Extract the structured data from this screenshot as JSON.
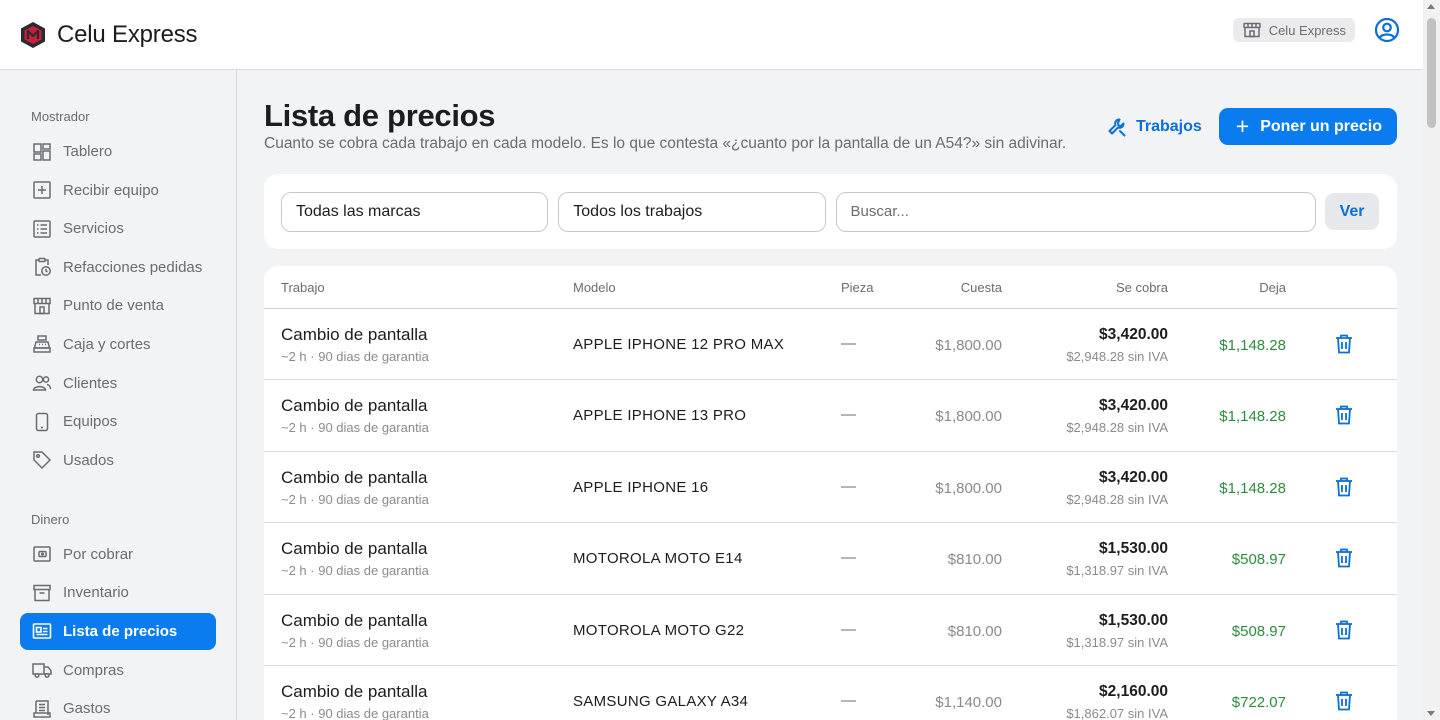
{
  "header": {
    "brand_name": "Celu Express",
    "store_chip": "Celu Express"
  },
  "colors": {
    "accent": "#0a7cf0",
    "profit_green": "#2e8b3e"
  },
  "sidebar": {
    "section_1": "Mostrador",
    "section_2": "Dinero",
    "items": [
      {
        "label": "Tablero",
        "icon": "dashboard-icon"
      },
      {
        "label": "Recibir equipo",
        "icon": "plus-square-icon"
      },
      {
        "label": "Servicios",
        "icon": "list-icon"
      },
      {
        "label": "Refacciones pedidas",
        "icon": "clipboard-clock-icon"
      },
      {
        "label": "Punto de venta",
        "icon": "store-icon"
      },
      {
        "label": "Caja y cortes",
        "icon": "cash-register-icon"
      },
      {
        "label": "Clientes",
        "icon": "users-icon"
      },
      {
        "label": "Equipos",
        "icon": "phone-icon"
      },
      {
        "label": "Usados",
        "icon": "tag-icon"
      },
      {
        "label": "Por cobrar",
        "icon": "wallet-icon"
      },
      {
        "label": "Inventario",
        "icon": "archive-icon"
      },
      {
        "label": "Lista de precios",
        "icon": "price-list-icon",
        "active": true
      },
      {
        "label": "Compras",
        "icon": "truck-icon"
      },
      {
        "label": "Gastos",
        "icon": "receipt-icon"
      }
    ]
  },
  "page": {
    "title": "Lista de precios",
    "subtitle": "Cuanto se cobra cada trabajo en cada modelo. Es lo que contesta «¿cuanto por la pantalla de un A54?» sin adivinar.",
    "trabajos_label": "Trabajos",
    "add_price_label": "Poner un precio"
  },
  "filters": {
    "brand": "Todas las marcas",
    "job": "Todos los trabajos",
    "search_placeholder": "Buscar...",
    "search_value": "",
    "ver_label": "Ver"
  },
  "table": {
    "headers": {
      "job": "Trabajo",
      "model": "Modelo",
      "part": "Pieza",
      "cost": "Cuesta",
      "price": "Se cobra",
      "profit": "Deja"
    },
    "rows": [
      {
        "job": "Cambio de pantalla",
        "meta": "~2 h · 90 dias de garantia",
        "model": "APPLE IPHONE 12 PRO MAX",
        "part": "—",
        "cost": "$1,800.00",
        "price": "$3,420.00",
        "price_net": "$2,948.28 sin IVA",
        "profit": "$1,148.28"
      },
      {
        "job": "Cambio de pantalla",
        "meta": "~2 h · 90 dias de garantia",
        "model": "APPLE IPHONE 13 PRO",
        "part": "—",
        "cost": "$1,800.00",
        "price": "$3,420.00",
        "price_net": "$2,948.28 sin IVA",
        "profit": "$1,148.28"
      },
      {
        "job": "Cambio de pantalla",
        "meta": "~2 h · 90 dias de garantia",
        "model": "APPLE IPHONE 16",
        "part": "—",
        "cost": "$1,800.00",
        "price": "$3,420.00",
        "price_net": "$2,948.28 sin IVA",
        "profit": "$1,148.28"
      },
      {
        "job": "Cambio de pantalla",
        "meta": "~2 h · 90 dias de garantia",
        "model": "MOTOROLA MOTO E14",
        "part": "—",
        "cost": "$810.00",
        "price": "$1,530.00",
        "price_net": "$1,318.97 sin IVA",
        "profit": "$508.97"
      },
      {
        "job": "Cambio de pantalla",
        "meta": "~2 h · 90 dias de garantia",
        "model": "MOTOROLA MOTO G22",
        "part": "—",
        "cost": "$810.00",
        "price": "$1,530.00",
        "price_net": "$1,318.97 sin IVA",
        "profit": "$508.97"
      },
      {
        "job": "Cambio de pantalla",
        "meta": "~2 h · 90 dias de garantia",
        "model": "SAMSUNG GALAXY A34",
        "part": "—",
        "cost": "$1,140.00",
        "price": "$2,160.00",
        "price_net": "$1,862.07 sin IVA",
        "profit": "$722.07"
      }
    ]
  }
}
